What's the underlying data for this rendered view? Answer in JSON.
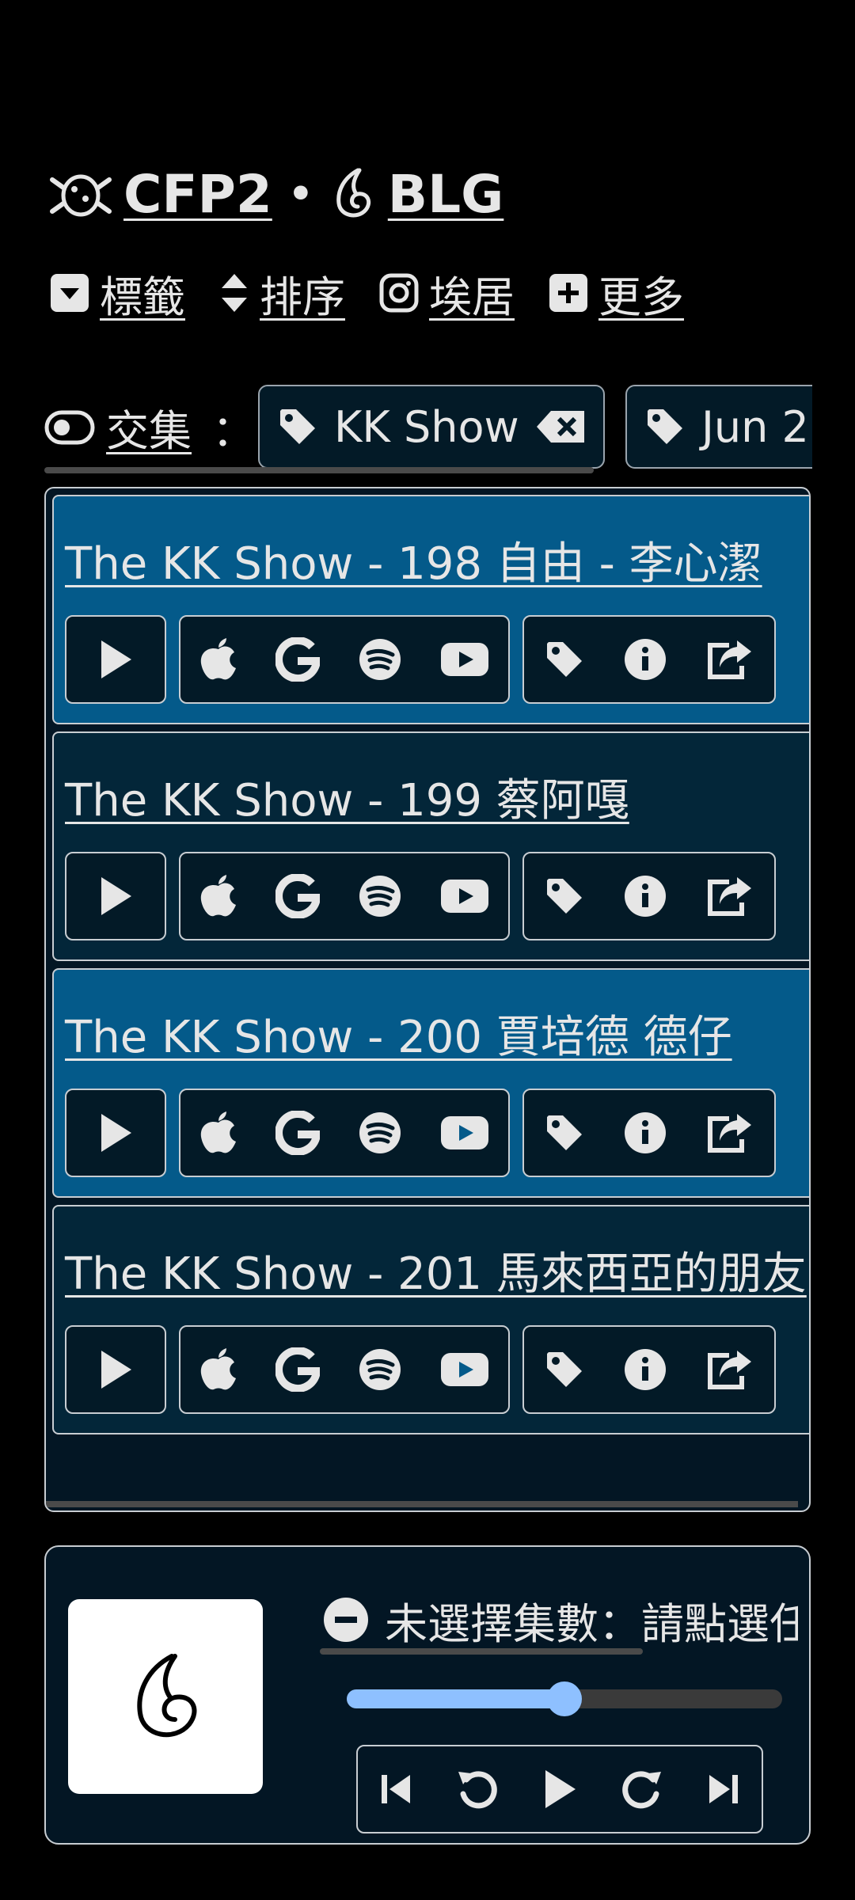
{
  "header": {
    "podcast_label": "CFP2",
    "separator": "•",
    "network_label": "BLG"
  },
  "nav": {
    "tags_label": "標籤",
    "sort_label": "排序",
    "instagram_label": "埃居",
    "more_label": "更多"
  },
  "filter": {
    "mode_label": "交集",
    "colon": "：",
    "chips": [
      "KK Show",
      "Jun 2"
    ]
  },
  "episodes": [
    {
      "title": "The KK Show - 198 自由 - 李心潔",
      "highlight": true
    },
    {
      "title": "The KK Show - 199 蔡阿嘎",
      "highlight": false
    },
    {
      "title": "The KK Show - 200 賈培德 德仔",
      "highlight": true
    },
    {
      "title": "The KK Show - 201 馬來西亞的朋友",
      "highlight": false
    }
  ],
  "player": {
    "status_text": "未選擇集數：請點選任",
    "progress": 0.5
  },
  "colors": {
    "highlight": "#045a8a",
    "dark_row": "#032639",
    "accent": "#8ec0ff"
  }
}
